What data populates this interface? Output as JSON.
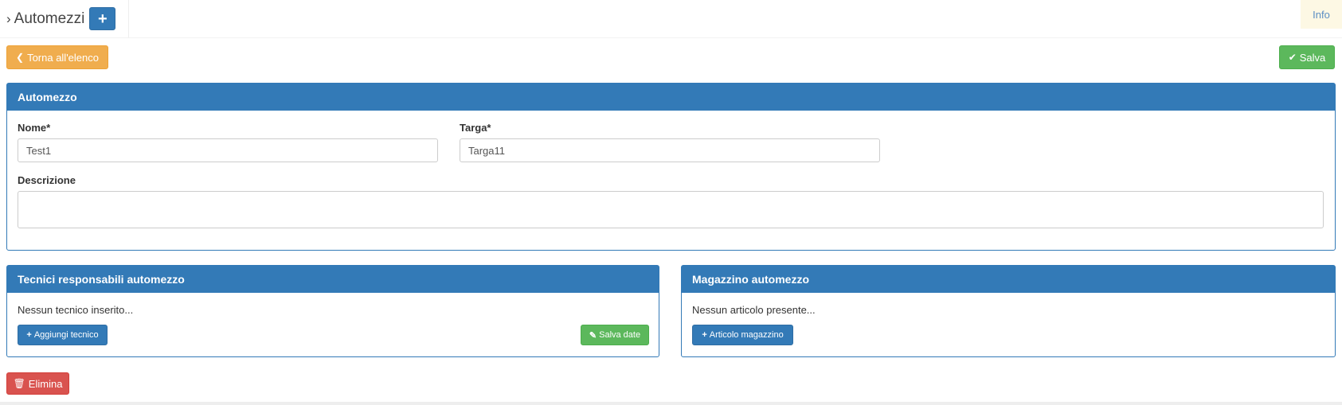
{
  "header": {
    "title": "Automezzi",
    "add_icon": "plus-icon",
    "info_label": "Info"
  },
  "toolbar": {
    "back_label": "Torna all'elenco",
    "back_icon": "chevron-left-icon",
    "save_label": "Salva",
    "save_icon": "check-icon"
  },
  "automezzo": {
    "panel_title": "Automezzo",
    "nome_label": "Nome*",
    "nome_value": "Test1",
    "targa_label": "Targa*",
    "targa_value": "Targa11",
    "descrizione_label": "Descrizione",
    "descrizione_value": ""
  },
  "tecnici": {
    "panel_title": "Tecnici responsabili automezzo",
    "empty_text": "Nessun tecnico inserito...",
    "add_label": "Aggiungi tecnico",
    "save_dates_label": "Salva date"
  },
  "magazzino": {
    "panel_title": "Magazzino automezzo",
    "empty_text": "Nessun articolo presente...",
    "add_label": "Articolo magazzino"
  },
  "footer": {
    "delete_label": "Elimina",
    "delete_icon": "trash-icon"
  },
  "colors": {
    "primary": "#337ab7",
    "warning": "#f0ad4e",
    "success": "#5cb85c",
    "danger": "#d9534f",
    "info_bg": "#fdf8e4"
  }
}
